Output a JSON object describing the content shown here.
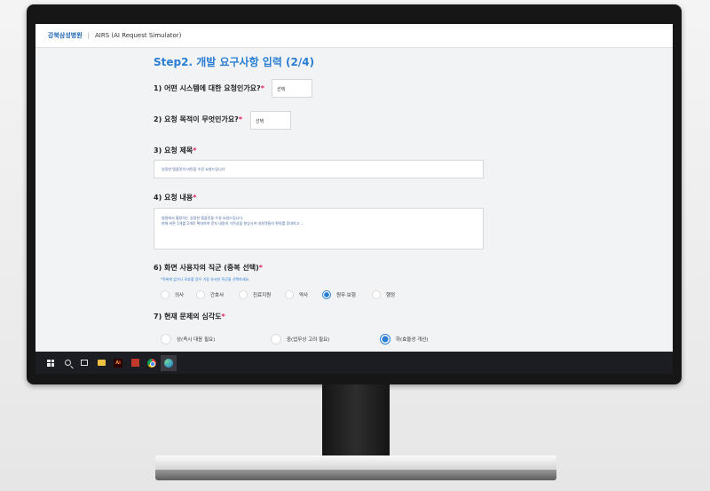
{
  "header": {
    "hospital_name": "강북삼성병원",
    "separator": "|",
    "app_name": "AIRS (AI Request Simulator)"
  },
  "step_title": "Step2. 개발 요구사항 입력 (2/4)",
  "required_mark": "*",
  "questions": {
    "q1": {
      "label": "1) 어떤 시스템에 대한 요청인가요?",
      "select_value": "선택"
    },
    "q2": {
      "label": "2) 요청 목적이 무엇인가요?",
      "select_value": "선택"
    },
    "q3": {
      "label": "3) 요청 제목",
      "value": "일정한 템플릿의 버튼을 수정 요청드립니다"
    },
    "q4": {
      "label": "4) 요청 내용",
      "line1": "병원에서 활용하는 일정한 템플릿을 수정 요청드립니다.",
      "line2": "현재 버튼 1개를 2개로 확대하여 문자 내용의 가독성을 향상시켜 내원객들의 편의를 증대하고 ..."
    },
    "q6": {
      "label": "6) 화면 사용자의 직군 (중복 선택)",
      "hint": "*직위에 없거나 모호할 경우 가장 유사한 직군을 선택하세요.",
      "options": [
        "의사",
        "간호사",
        "진료지원",
        "약사",
        "원무·보험",
        "행정"
      ],
      "selected": "원무·보험"
    },
    "q7": {
      "label": "7) 현재 문제의 심각도",
      "options": [
        "상(즉시 대응 필요)",
        "중(업무상 고려 필요)",
        "하(효율성 개선)"
      ],
      "selected": "하(효율성 개선)"
    }
  },
  "taskbar": {
    "icons": [
      "windows-start-icon",
      "search-icon",
      "task-view-icon",
      "file-explorer-icon",
      "illustrator-icon",
      "app-icon",
      "chrome-icon",
      "edge-icon"
    ],
    "ai_label": "Ai"
  },
  "colors": {
    "accent": "#2a7fd4",
    "required": "#e0245e",
    "taskbar": "#1c1d22",
    "bezel": "#161616"
  }
}
